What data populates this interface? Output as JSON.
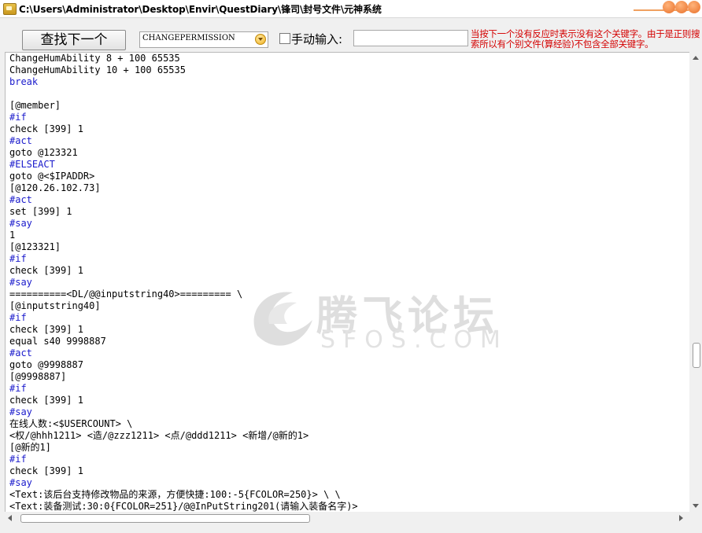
{
  "window": {
    "title": "C:\\Users\\Administrator\\Desktop\\Envir\\QuestDiary\\锋司\\封号文件\\元神系统"
  },
  "toolbar": {
    "find_next_label": "查找下一个",
    "keyword_select_value": "CHANGEPERMISSION",
    "manual_input_label": "手动输入:",
    "manual_input_value": "",
    "hint_text": "当按下一个没有反应时表示没有这个关键字。由于是正则搜索所以有个别文件(算经验)不包含全部关键字。"
  },
  "watermark": {
    "cn": "腾飞论坛",
    "en": "SFOS.COM"
  },
  "editor": {
    "lines": [
      {
        "text": "ChangeHumAbility 8 + 100 65535",
        "kw": false
      },
      {
        "text": "ChangeHumAbility 10 + 100 65535",
        "kw": false
      },
      {
        "text": "break",
        "kw": true
      },
      {
        "text": "",
        "kw": false
      },
      {
        "text": "[@member]",
        "kw": false
      },
      {
        "text": "#if",
        "kw": true
      },
      {
        "text": "check [399] 1",
        "kw": false
      },
      {
        "text": "#act",
        "kw": true
      },
      {
        "text": "goto @123321",
        "kw": false
      },
      {
        "text": "#ELSEACT",
        "kw": true
      },
      {
        "text": "goto @<$IPADDR>",
        "kw": false
      },
      {
        "text": "[@120.26.102.73]",
        "kw": false
      },
      {
        "text": "#act",
        "kw": true
      },
      {
        "text": "set [399] 1",
        "kw": false
      },
      {
        "text": "#say",
        "kw": true
      },
      {
        "text": "1",
        "kw": false
      },
      {
        "text": "[@123321]",
        "kw": false
      },
      {
        "text": "#if",
        "kw": true
      },
      {
        "text": "check [399] 1",
        "kw": false
      },
      {
        "text": "#say",
        "kw": true
      },
      {
        "text": "==========<DL/@@inputstring40>========= \\",
        "kw": false
      },
      {
        "text": "[@inputstring40]",
        "kw": false
      },
      {
        "text": "#if",
        "kw": true
      },
      {
        "text": "check [399] 1",
        "kw": false
      },
      {
        "text": "equal s40 9998887",
        "kw": false
      },
      {
        "text": "#act",
        "kw": true
      },
      {
        "text": "goto @9998887",
        "kw": false
      },
      {
        "text": "[@9998887]",
        "kw": false
      },
      {
        "text": "#if",
        "kw": true
      },
      {
        "text": "check [399] 1",
        "kw": false
      },
      {
        "text": "#say",
        "kw": true
      },
      {
        "text": "在线人数:<$USERCOUNT> \\",
        "kw": false
      },
      {
        "text": "<权/@hhh1211> <造/@zzz1211> <点/@ddd1211> <新增/@新的1>",
        "kw": false
      },
      {
        "text": "[@新的1]",
        "kw": false
      },
      {
        "text": "#if",
        "kw": true
      },
      {
        "text": "check [399] 1",
        "kw": false
      },
      {
        "text": "#say",
        "kw": true
      },
      {
        "text": "<Text:该后台支持修改物品的来源，方便快捷:100:-5{FCOLOR=250}> \\ \\",
        "kw": false
      },
      {
        "text": "<Text:装备测试:30:0{FCOLOR=251}/@@InPutString201(请输入装备名字)>",
        "kw": false
      }
    ]
  },
  "colors": {
    "keyword": "#1a1acc",
    "hint": "#d40000"
  }
}
